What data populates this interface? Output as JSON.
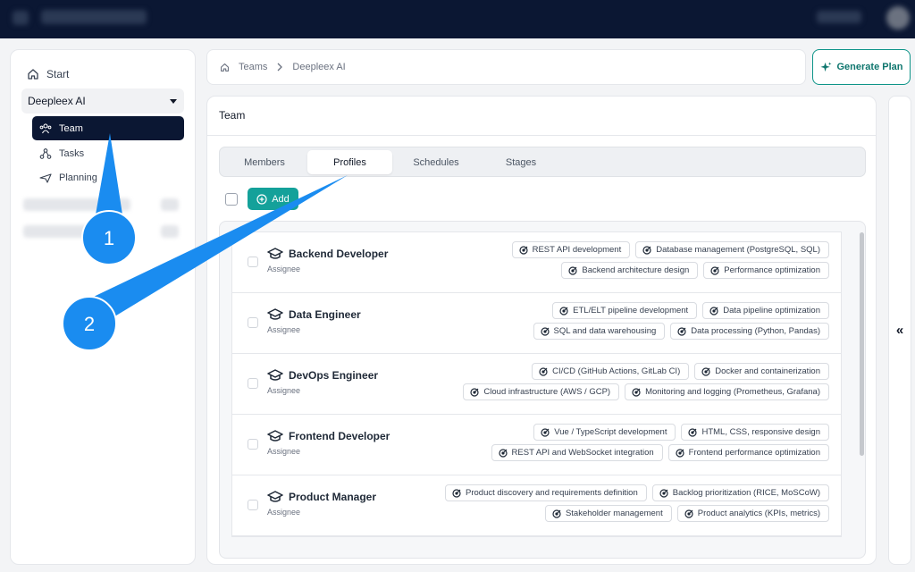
{
  "sidebar": {
    "start_label": "Start",
    "org_name": "Deepleex AI",
    "items": [
      {
        "label": "Team"
      },
      {
        "label": "Tasks"
      },
      {
        "label": "Planning"
      }
    ]
  },
  "breadcrumb": {
    "items": [
      "Teams",
      "Deepleex AI"
    ]
  },
  "generate_plan_label": "Generate Plan",
  "main": {
    "title": "Team",
    "tabs": [
      "Members",
      "Profiles",
      "Schedules",
      "Stages"
    ],
    "active_tab": "Profiles",
    "add_label": "Add"
  },
  "profiles": [
    {
      "title": "Backend Developer",
      "subtitle": "Assignee",
      "chips_top": [
        "REST API development",
        "Database management (PostgreSQL, SQL)"
      ],
      "chips_bottom": [
        "Backend architecture design",
        "Performance optimization"
      ]
    },
    {
      "title": "Data Engineer",
      "subtitle": "Assignee",
      "chips_top": [
        "ETL/ELT pipeline development",
        "Data pipeline optimization"
      ],
      "chips_bottom": [
        "SQL and data warehousing",
        "Data processing (Python, Pandas)"
      ]
    },
    {
      "title": "DevOps Engineer",
      "subtitle": "Assignee",
      "chips_top": [
        "CI/CD (GitHub Actions, GitLab CI)",
        "Docker and containerization"
      ],
      "chips_bottom": [
        "Cloud infrastructure (AWS / GCP)",
        "Monitoring and logging (Prometheus, Grafana)"
      ]
    },
    {
      "title": "Frontend Developer",
      "subtitle": "Assignee",
      "chips_top": [
        "Vue / TypeScript development",
        "HTML, CSS, responsive design"
      ],
      "chips_bottom": [
        "REST API and WebSocket integration",
        "Frontend performance optimization"
      ]
    },
    {
      "title": "Product Manager",
      "subtitle": "Assignee",
      "chips_top": [
        "Product discovery and requirements definition",
        "Backlog prioritization (RICE, MoSCoW)"
      ],
      "chips_bottom": [
        "Stakeholder management",
        "Product analytics (KPIs, metrics)"
      ]
    }
  ],
  "collapse_label": "«",
  "annotations": {
    "marker_1": "1",
    "marker_2": "2",
    "color": "#1a8cf0"
  }
}
